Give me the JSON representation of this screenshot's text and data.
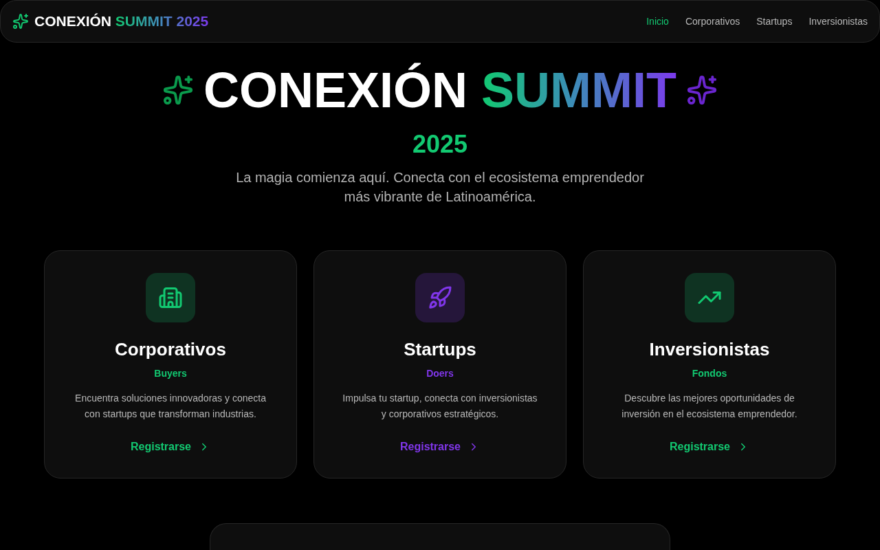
{
  "nav": {
    "logo": {
      "text": "CONEXIÓN",
      "highlight": "SUMMIT 2025"
    },
    "links": [
      {
        "label": "Inicio",
        "selected": true
      },
      {
        "label": "Corporativos",
        "selected": false
      },
      {
        "label": "Startups",
        "selected": false
      },
      {
        "label": "Inversionistas",
        "selected": false
      }
    ]
  },
  "hero": {
    "title": "CONEXIÓN",
    "title_highlight": "SUMMIT",
    "year": "2025",
    "tagline": "La magia comienza aquí. Conecta con el ecosistema emprendedor más vibrante de Latinoamérica."
  },
  "cards": [
    {
      "kind": "building",
      "title": "Corporativos",
      "tag": "Buyers",
      "color": "#12c971",
      "description": "Encuentra soluciones innovadoras y conecta con startups que transforman industrias.",
      "action": "Registrarse"
    },
    {
      "kind": "rocket",
      "title": "Startups",
      "tag": "Doers",
      "color": "#8036ea",
      "description": "Impulsa tu startup, conecta con inversionistas y corporativos estratégicos.",
      "action": "Registrarse"
    },
    {
      "kind": "trend",
      "title": "Inversionistas",
      "tag": "Fondos",
      "color": "#12c971",
      "description": "Descubre las mejores oportunidades de inversión en el ecosistema emprendedor.",
      "action": "Registrarse"
    }
  ]
}
